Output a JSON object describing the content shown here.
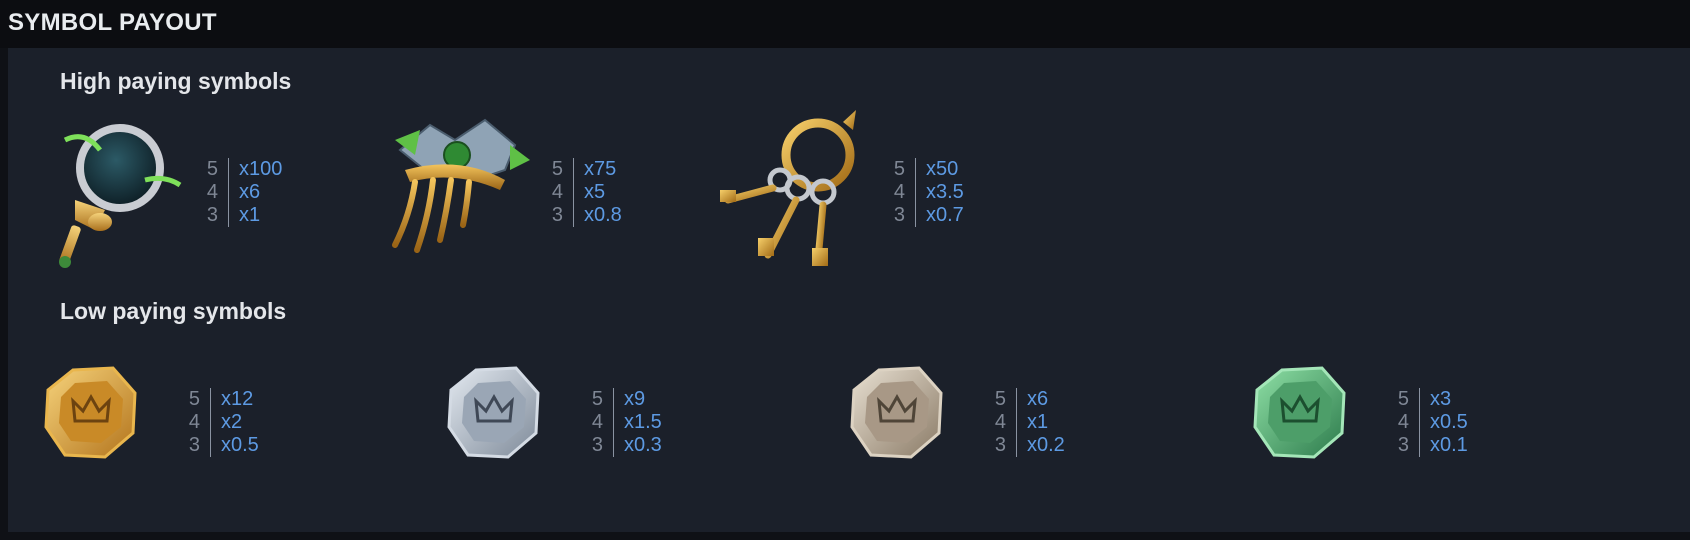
{
  "header": {
    "title": "SYMBOL PAYOUT"
  },
  "sections": {
    "high": {
      "title": "High paying symbols"
    },
    "low": {
      "title": "Low paying symbols"
    }
  },
  "symbols": [
    {
      "icon": "ornate-mirror-icon",
      "payouts": [
        {
          "count": "5",
          "mult": "x100"
        },
        {
          "count": "4",
          "mult": "x6"
        },
        {
          "count": "3",
          "mult": "x1"
        }
      ]
    },
    {
      "icon": "hair-comb-icon",
      "payouts": [
        {
          "count": "5",
          "mult": "x75"
        },
        {
          "count": "4",
          "mult": "x5"
        },
        {
          "count": "3",
          "mult": "x0.8"
        }
      ]
    },
    {
      "icon": "key-ring-icon",
      "payouts": [
        {
          "count": "5",
          "mult": "x50"
        },
        {
          "count": "4",
          "mult": "x3.5"
        },
        {
          "count": "3",
          "mult": "x0.7"
        }
      ]
    },
    {
      "icon": "gold-crown-coin-icon",
      "payouts": [
        {
          "count": "5",
          "mult": "x12"
        },
        {
          "count": "4",
          "mult": "x2"
        },
        {
          "count": "3",
          "mult": "x0.5"
        }
      ]
    },
    {
      "icon": "silver-crown-coin-icon",
      "payouts": [
        {
          "count": "5",
          "mult": "x9"
        },
        {
          "count": "4",
          "mult": "x1.5"
        },
        {
          "count": "3",
          "mult": "x0.3"
        }
      ]
    },
    {
      "icon": "bronze-crown-coin-icon",
      "payouts": [
        {
          "count": "5",
          "mult": "x6"
        },
        {
          "count": "4",
          "mult": "x1"
        },
        {
          "count": "3",
          "mult": "x0.2"
        }
      ]
    },
    {
      "icon": "jade-crown-coin-icon",
      "payouts": [
        {
          "count": "5",
          "mult": "x3"
        },
        {
          "count": "4",
          "mult": "x0.5"
        },
        {
          "count": "3",
          "mult": "x0.1"
        }
      ]
    }
  ],
  "colors": {
    "background": "#1b202a",
    "header": "#0c0d11",
    "multiplier": "#5d9ae3",
    "count": "#7f8795"
  }
}
